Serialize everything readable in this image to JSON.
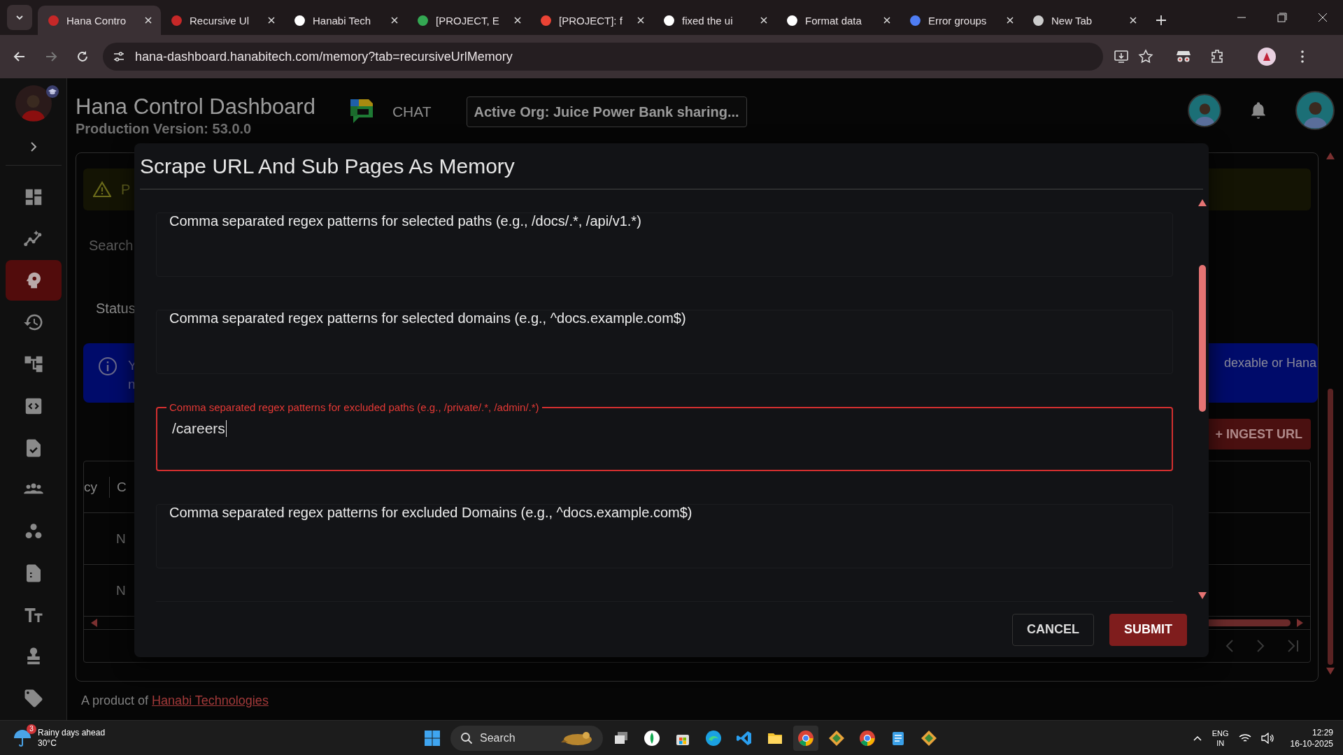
{
  "browser": {
    "tabs": [
      {
        "title": "Hana Contro",
        "selected": true
      },
      {
        "title": "Recursive Ul",
        "selected": false
      },
      {
        "title": "Hanabi Tech",
        "selected": false
      },
      {
        "title": "[PROJECT, E",
        "selected": false
      },
      {
        "title": "[PROJECT]: f",
        "selected": false
      },
      {
        "title": "fixed the ui",
        "selected": false
      },
      {
        "title": "Format data",
        "selected": false
      },
      {
        "title": "Error groups",
        "selected": false
      },
      {
        "title": "New Tab",
        "selected": false
      }
    ],
    "url": "hana-dashboard.hanabitech.com/memory?tab=recursiveUrlMemory"
  },
  "sidebar": {
    "items": [
      {
        "selected": false
      },
      {
        "selected": false
      },
      {
        "selected": true
      },
      {
        "selected": false
      },
      {
        "selected": false
      },
      {
        "selected": false
      },
      {
        "selected": false
      },
      {
        "selected": false
      },
      {
        "selected": false
      },
      {
        "selected": false
      },
      {
        "selected": false
      },
      {
        "selected": false
      },
      {
        "selected": false
      }
    ]
  },
  "header": {
    "title": "Hana Control Dashboard",
    "version": "Production Version: 53.0.0",
    "chat_label": "CHAT",
    "active_org": "Active Org: Juice Power Bank sharing..."
  },
  "background": {
    "warning_text": "P",
    "search_text": "Search",
    "status_text": "Status",
    "info_lines": [
      "Y",
      "n"
    ],
    "info_right": "dexable or Hana",
    "ingest_button": "+ INGEST URL",
    "table": {
      "columns": [
        "cy",
        "C"
      ],
      "rows": [
        "N",
        "N"
      ]
    }
  },
  "dialog": {
    "title": "Scrape URL And Sub Pages As Memory",
    "fields": [
      {
        "label": "Comma separated regex patterns for selected paths (e.g., /docs/.*, /api/v1.*)",
        "focused": false
      },
      {
        "label": "Comma separated regex patterns for selected domains (e.g., ^docs.example.com$)",
        "focused": false
      },
      {
        "label": "Comma separated regex patterns for excluded paths (e.g., /private/.*, /admin/.*)",
        "value": "/careers",
        "focused": true
      },
      {
        "label": "Comma separated regex patterns for excluded Domains (e.g., ^docs.example.com$)",
        "focused": false
      }
    ],
    "buttons": [
      {
        "label": "CANCEL",
        "kind": "secondary"
      },
      {
        "label": "SUBMIT",
        "kind": "primary"
      }
    ]
  },
  "footer": {
    "text": "A product of",
    "link": "Hanabi Technologies"
  },
  "taskbar": {
    "weather": {
      "badge": "3",
      "title": "Rainy days ahead",
      "temp": "30°C"
    },
    "search": "Search",
    "language": [
      "ENG",
      "IN"
    ],
    "time": "12:29",
    "date": "16-10-2025"
  }
}
